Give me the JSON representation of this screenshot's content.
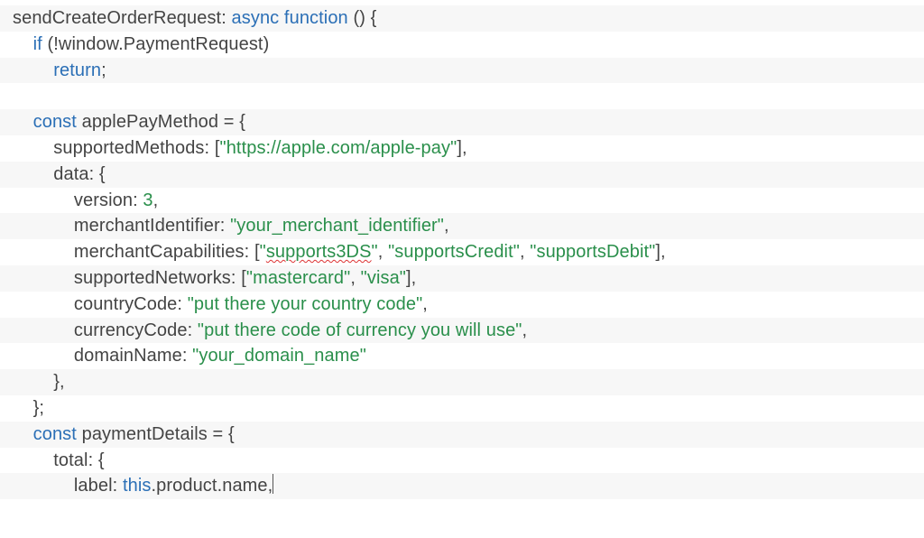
{
  "code": {
    "lines": [
      {
        "indent": 0,
        "bg": "odd",
        "tokens": [
          {
            "cls": "t-plain",
            "text": "sendCreateOrderRequest: "
          },
          {
            "cls": "t-kw",
            "text": "async function"
          },
          {
            "cls": "t-plain",
            "text": " () {"
          }
        ]
      },
      {
        "indent": 1,
        "bg": "even",
        "tokens": [
          {
            "cls": "t-kw",
            "text": "if"
          },
          {
            "cls": "t-plain",
            "text": " (!window.PaymentRequest)"
          }
        ]
      },
      {
        "indent": 2,
        "bg": "odd",
        "tokens": [
          {
            "cls": "t-kw",
            "text": "return"
          },
          {
            "cls": "t-plain",
            "text": ";"
          }
        ]
      },
      {
        "indent": 0,
        "bg": "even",
        "tokens": []
      },
      {
        "indent": 1,
        "bg": "odd",
        "tokens": [
          {
            "cls": "t-kw",
            "text": "const"
          },
          {
            "cls": "t-plain",
            "text": " applePayMethod = {"
          }
        ]
      },
      {
        "indent": 2,
        "bg": "even",
        "tokens": [
          {
            "cls": "t-plain",
            "text": "supportedMethods: ["
          },
          {
            "cls": "t-str",
            "text": "\"https://apple.com/apple-pay\""
          },
          {
            "cls": "t-plain",
            "text": "],"
          }
        ]
      },
      {
        "indent": 2,
        "bg": "odd",
        "tokens": [
          {
            "cls": "t-plain",
            "text": "data: {"
          }
        ]
      },
      {
        "indent": 3,
        "bg": "even",
        "tokens": [
          {
            "cls": "t-plain",
            "text": "version: "
          },
          {
            "cls": "t-num",
            "text": "3"
          },
          {
            "cls": "t-plain",
            "text": ","
          }
        ]
      },
      {
        "indent": 3,
        "bg": "odd",
        "tokens": [
          {
            "cls": "t-plain",
            "text": "merchantIdentifier: "
          },
          {
            "cls": "t-str",
            "text": "\"your_merchant_identifier\""
          },
          {
            "cls": "t-plain",
            "text": ","
          }
        ]
      },
      {
        "indent": 3,
        "bg": "even",
        "tokens": [
          {
            "cls": "t-plain",
            "text": "merchantCapabilities: ["
          },
          {
            "cls": "t-str",
            "text": "\""
          },
          {
            "cls": "t-str spellerr",
            "text": "supports3DS"
          },
          {
            "cls": "t-str",
            "text": "\""
          },
          {
            "cls": "t-plain",
            "text": ", "
          },
          {
            "cls": "t-str",
            "text": "\"supportsCredit\""
          },
          {
            "cls": "t-plain",
            "text": ", "
          },
          {
            "cls": "t-str",
            "text": "\"supportsDebit\""
          },
          {
            "cls": "t-plain",
            "text": "],"
          }
        ]
      },
      {
        "indent": 3,
        "bg": "odd",
        "tokens": [
          {
            "cls": "t-plain",
            "text": "supportedNetworks: ["
          },
          {
            "cls": "t-str",
            "text": "\"mastercard\""
          },
          {
            "cls": "t-plain",
            "text": ", "
          },
          {
            "cls": "t-str",
            "text": "\"visa\""
          },
          {
            "cls": "t-plain",
            "text": "],"
          }
        ]
      },
      {
        "indent": 3,
        "bg": "even",
        "tokens": [
          {
            "cls": "t-plain",
            "text": "countryCode: "
          },
          {
            "cls": "t-str",
            "text": "\"put there your country code\""
          },
          {
            "cls": "t-plain",
            "text": ","
          }
        ]
      },
      {
        "indent": 3,
        "bg": "odd",
        "tokens": [
          {
            "cls": "t-plain",
            "text": "currencyCode: "
          },
          {
            "cls": "t-str",
            "text": "\"put there code of currency you will use\""
          },
          {
            "cls": "t-plain",
            "text": ","
          }
        ]
      },
      {
        "indent": 3,
        "bg": "even",
        "tokens": [
          {
            "cls": "t-plain",
            "text": "domainName: "
          },
          {
            "cls": "t-str",
            "text": "\"your_domain_name\""
          }
        ]
      },
      {
        "indent": 2,
        "bg": "odd",
        "tokens": [
          {
            "cls": "t-plain",
            "text": "},"
          }
        ]
      },
      {
        "indent": 1,
        "bg": "even",
        "tokens": [
          {
            "cls": "t-plain",
            "text": "};"
          }
        ]
      },
      {
        "indent": 1,
        "bg": "odd",
        "tokens": [
          {
            "cls": "t-kw",
            "text": "const"
          },
          {
            "cls": "t-plain",
            "text": " paymentDetails = {"
          }
        ]
      },
      {
        "indent": 2,
        "bg": "even",
        "tokens": [
          {
            "cls": "t-plain",
            "text": "total: {"
          }
        ]
      },
      {
        "indent": 3,
        "bg": "odd",
        "caret": true,
        "tokens": [
          {
            "cls": "t-plain",
            "text": "label: "
          },
          {
            "cls": "t-kw",
            "text": "this"
          },
          {
            "cls": "t-plain",
            "text": ".product.name,"
          }
        ]
      }
    ]
  }
}
